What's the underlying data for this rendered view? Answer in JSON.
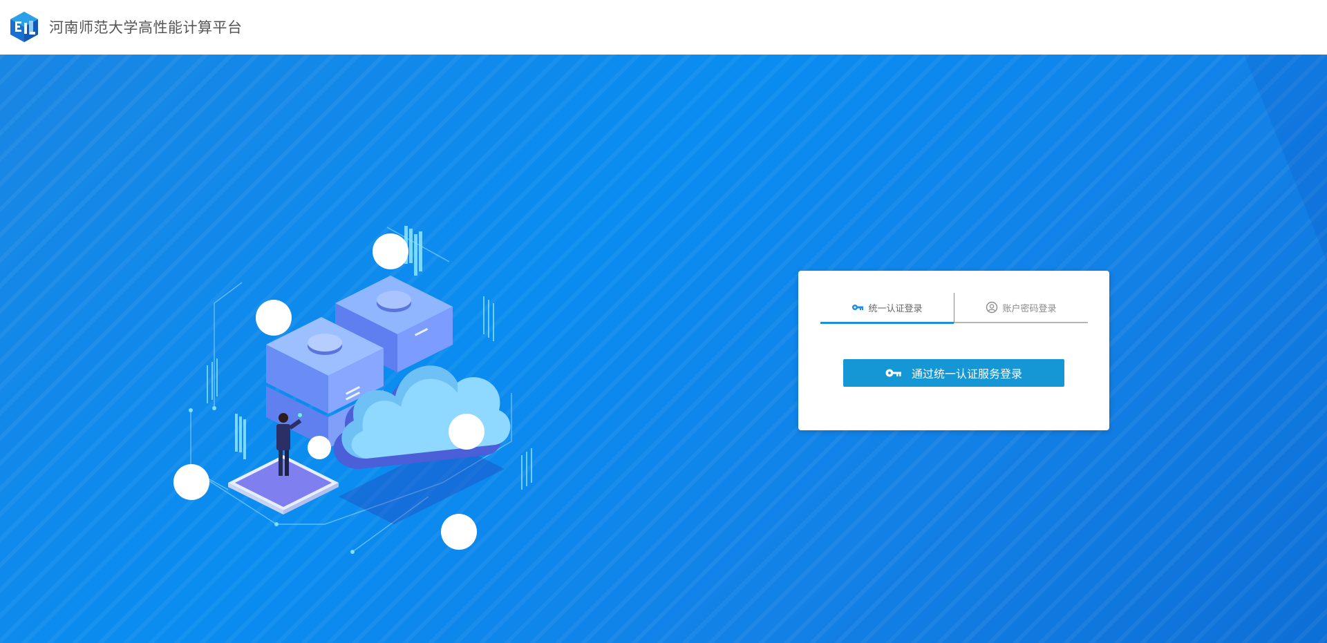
{
  "header": {
    "title": "河南师范大学高性能计算平台",
    "logo_icon": "hpc-cube-logo-icon"
  },
  "login": {
    "tabs": [
      {
        "label": "统一认证登录",
        "icon": "key-icon",
        "active": true
      },
      {
        "label": "账户密码登录",
        "icon": "user-circle-icon",
        "active": false
      }
    ],
    "sso_button_label": "通过统一认证服务登录",
    "sso_button_icon": "key-icon"
  },
  "colors": {
    "accent": "#1597d6",
    "tab_active": "#1a8fe0",
    "hero_bg": "#0a8cf0"
  }
}
